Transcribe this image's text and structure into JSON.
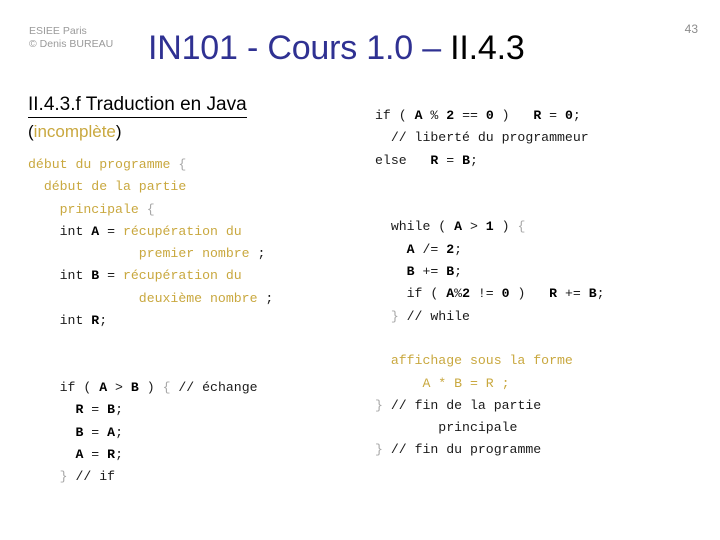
{
  "header": {
    "institution": "ESIEE Paris",
    "copyright": "© Denis BUREAU",
    "title_course": "IN101 - Cours 1.0 – ",
    "title_section": "II.4.3",
    "page_number": "43",
    "colors": {
      "title_blue": "#2f3192",
      "title_black": "#000000",
      "gray_text": "#9a9a9a",
      "accent_gold": "#c9a83f"
    }
  },
  "left": {
    "heading": "II.4.3.f Traduction en Java",
    "subheading_open": "(",
    "subheading_accent": "incomplète",
    "subheading_close": ")",
    "code": [
      {
        "indent": 0,
        "parts": [
          {
            "t": "début du programme ",
            "c": "pseudo"
          },
          {
            "t": "{",
            "c": "brace"
          }
        ]
      },
      {
        "indent": 1,
        "parts": [
          {
            "t": "début de la partie",
            "c": "pseudo"
          }
        ]
      },
      {
        "indent": 2,
        "parts": [
          {
            "t": "principale ",
            "c": "pseudo"
          },
          {
            "t": "{",
            "c": "brace"
          }
        ]
      },
      {
        "indent": 2,
        "parts": [
          {
            "t": "int ",
            "c": "plain"
          },
          {
            "t": "A",
            "c": "var"
          },
          {
            "t": " = ",
            "c": "plain"
          },
          {
            "t": "récupération du",
            "c": "pseudo"
          }
        ]
      },
      {
        "indent": 7,
        "parts": [
          {
            "t": "premier nombre ",
            "c": "pseudo"
          },
          {
            "t": ";",
            "c": "plain"
          }
        ]
      },
      {
        "indent": 2,
        "parts": [
          {
            "t": "int ",
            "c": "plain"
          },
          {
            "t": "B",
            "c": "var"
          },
          {
            "t": " = ",
            "c": "plain"
          },
          {
            "t": "récupération du",
            "c": "pseudo"
          }
        ]
      },
      {
        "indent": 7,
        "parts": [
          {
            "t": "deuxième nombre ",
            "c": "pseudo"
          },
          {
            "t": ";",
            "c": "plain"
          }
        ]
      },
      {
        "indent": 2,
        "parts": [
          {
            "t": "int ",
            "c": "plain"
          },
          {
            "t": "R",
            "c": "var"
          },
          {
            "t": ";",
            "c": "plain"
          }
        ]
      },
      {
        "indent": 0,
        "parts": []
      },
      {
        "indent": 0,
        "parts": []
      },
      {
        "indent": 2,
        "parts": [
          {
            "t": "if ( ",
            "c": "plain"
          },
          {
            "t": "A",
            "c": "var"
          },
          {
            "t": " > ",
            "c": "plain"
          },
          {
            "t": "B",
            "c": "var"
          },
          {
            "t": " ) ",
            "c": "plain"
          },
          {
            "t": "{",
            "c": "brace"
          },
          {
            "t": " // échange",
            "c": "plain"
          }
        ]
      },
      {
        "indent": 3,
        "parts": [
          {
            "t": "R",
            "c": "var"
          },
          {
            "t": " = ",
            "c": "plain"
          },
          {
            "t": "B",
            "c": "var"
          },
          {
            "t": ";",
            "c": "plain"
          }
        ]
      },
      {
        "indent": 3,
        "parts": [
          {
            "t": "B",
            "c": "var"
          },
          {
            "t": " = ",
            "c": "plain"
          },
          {
            "t": "A",
            "c": "var"
          },
          {
            "t": ";",
            "c": "plain"
          }
        ]
      },
      {
        "indent": 3,
        "parts": [
          {
            "t": "A",
            "c": "var"
          },
          {
            "t": " = ",
            "c": "plain"
          },
          {
            "t": "R",
            "c": "var"
          },
          {
            "t": ";",
            "c": "plain"
          }
        ]
      },
      {
        "indent": 2,
        "parts": [
          {
            "t": "}",
            "c": "brace"
          },
          {
            "t": " // if",
            "c": "plain"
          }
        ]
      }
    ]
  },
  "right": {
    "code": [
      {
        "indent": 0,
        "parts": [
          {
            "t": "if ( ",
            "c": "plain"
          },
          {
            "t": "A",
            "c": "var"
          },
          {
            "t": " % ",
            "c": "plain"
          },
          {
            "t": "2",
            "c": "bold"
          },
          {
            "t": " == ",
            "c": "plain"
          },
          {
            "t": "0",
            "c": "bold"
          },
          {
            "t": " )   ",
            "c": "plain"
          },
          {
            "t": "R",
            "c": "var"
          },
          {
            "t": " = ",
            "c": "plain"
          },
          {
            "t": "0",
            "c": "bold"
          },
          {
            "t": ";",
            "c": "plain"
          }
        ]
      },
      {
        "indent": 1,
        "parts": [
          {
            "t": "// liberté du programmeur",
            "c": "plain"
          }
        ]
      },
      {
        "indent": 0,
        "parts": [
          {
            "t": "else   ",
            "c": "plain"
          },
          {
            "t": "R",
            "c": "var"
          },
          {
            "t": " = ",
            "c": "plain"
          },
          {
            "t": "B",
            "c": "var"
          },
          {
            "t": ";",
            "c": "plain"
          }
        ]
      },
      {
        "indent": 0,
        "parts": []
      },
      {
        "indent": 0,
        "parts": []
      },
      {
        "indent": 1,
        "parts": [
          {
            "t": "while ( ",
            "c": "plain"
          },
          {
            "t": "A",
            "c": "var"
          },
          {
            "t": " > ",
            "c": "plain"
          },
          {
            "t": "1",
            "c": "bold"
          },
          {
            "t": " ) ",
            "c": "plain"
          },
          {
            "t": "{",
            "c": "brace"
          }
        ]
      },
      {
        "indent": 2,
        "parts": [
          {
            "t": "A",
            "c": "var"
          },
          {
            "t": " /= ",
            "c": "plain"
          },
          {
            "t": "2",
            "c": "bold"
          },
          {
            "t": ";",
            "c": "plain"
          }
        ]
      },
      {
        "indent": 2,
        "parts": [
          {
            "t": "B",
            "c": "var"
          },
          {
            "t": " += ",
            "c": "plain"
          },
          {
            "t": "B",
            "c": "var"
          },
          {
            "t": ";",
            "c": "plain"
          }
        ]
      },
      {
        "indent": 2,
        "parts": [
          {
            "t": "if ( ",
            "c": "plain"
          },
          {
            "t": "A",
            "c": "var"
          },
          {
            "t": "%",
            "c": "plain"
          },
          {
            "t": "2",
            "c": "bold"
          },
          {
            "t": " != ",
            "c": "plain"
          },
          {
            "t": "0",
            "c": "bold"
          },
          {
            "t": " )   ",
            "c": "plain"
          },
          {
            "t": "R",
            "c": "var"
          },
          {
            "t": " += ",
            "c": "plain"
          },
          {
            "t": "B",
            "c": "var"
          },
          {
            "t": ";",
            "c": "plain"
          }
        ]
      },
      {
        "indent": 1,
        "parts": [
          {
            "t": "}",
            "c": "brace"
          },
          {
            "t": " // while",
            "c": "plain"
          }
        ]
      },
      {
        "indent": 0,
        "parts": []
      },
      {
        "indent": 1,
        "parts": [
          {
            "t": "affichage sous la forme",
            "c": "pseudo"
          }
        ]
      },
      {
        "indent": 3,
        "parts": [
          {
            "t": "A * B = R ;",
            "c": "pseudo"
          }
        ]
      },
      {
        "indent": 0,
        "parts": [
          {
            "t": "}",
            "c": "brace"
          },
          {
            "t": " // fin de la partie",
            "c": "plain"
          }
        ]
      },
      {
        "indent": 4,
        "parts": [
          {
            "t": "principale",
            "c": "plain"
          }
        ]
      },
      {
        "indent": -1,
        "parts": [
          {
            "t": "}",
            "c": "brace"
          },
          {
            "t": " // fin du programme",
            "c": "plain"
          }
        ]
      }
    ]
  }
}
